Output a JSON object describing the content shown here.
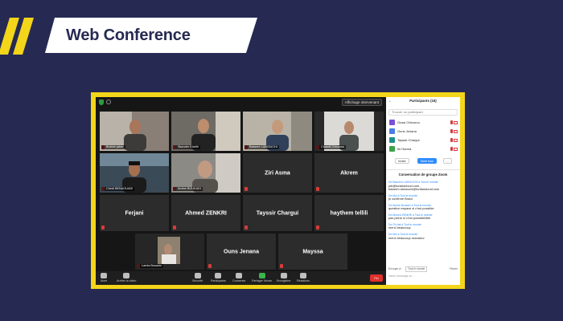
{
  "banner": {
    "title": "Web Conference"
  },
  "meeting": {
    "view_button": "Affichage intervenant",
    "tiles_video": [
      {
        "label": "Brahim jaber"
      },
      {
        "label": "Skander Khelifi"
      },
      {
        "label": "Bassem LAMOUCHI"
      },
      {
        "label": "Chawki Chtourou"
      },
      {
        "label": "Chedi BENAOUADI"
      },
      {
        "label": "Amine BOUKADI"
      },
      {
        "label": "Lamia Bouaziz"
      }
    ],
    "tiles_names": [
      "Ziri Asma",
      "Akrem",
      "Ferjani",
      "Ahmed ZENKRI",
      "Tayssir Chargui",
      "haythem tellili",
      "Ouns Jenana",
      "Mayssa"
    ],
    "toolbar": {
      "mute": "Muet",
      "stop_video": "Arrêter la vidéo",
      "security": "Sécurité",
      "participants": "Participants",
      "chat": "Converser",
      "share": "Partager l'écran",
      "record": "Enregistrer",
      "reactions": "Réactions",
      "end": "Fin"
    }
  },
  "panel": {
    "title": "Participants (15)",
    "search_placeholder": "Trouver un participant",
    "participants": [
      {
        "name": "Oussi Chtourou",
        "color": "#7b4fd6"
      },
      {
        "name": "Ouns Jenana",
        "color": "#4a7de8"
      },
      {
        "name": "Tayssir Chargui",
        "color": "#1f8f8f"
      },
      {
        "name": "Ibi Hamra",
        "color": "#3aa34a"
      }
    ],
    "invite": "Inviter",
    "mute_all": "Muet tous",
    "more": "...",
    "chat_title": "Conversation de groupe Zoom",
    "messages": [
      {
        "meta": "De Bassem LAMOUCHI à Tout le monde:",
        "text": "job@tunisiacloud.com , bassem.lamouchi@tunisiacloud.com"
      },
      {
        "meta": "De Moi à Tout le monde:",
        "text": "je confirme Bravo"
      },
      {
        "meta": "De Amine Bouaziz à Tout le monde:",
        "text": "question espace si c'est possible"
      },
      {
        "meta": "De Ahmed ZENKRI à Tout le monde:",
        "text": "pas peine si c'est possibbl/ibib"
      },
      {
        "meta": "De Oh bat à Tout le monde:",
        "text": "merci beaucoup"
      },
      {
        "meta": "De Moi à Tout le monde:",
        "text": "merci beaucoup monsieur"
      }
    ],
    "to_label": "Envoyer à :",
    "to_value": "Tout le monde",
    "file_label": "Fichier",
    "input_placeholder": "Saisir message ici..."
  }
}
